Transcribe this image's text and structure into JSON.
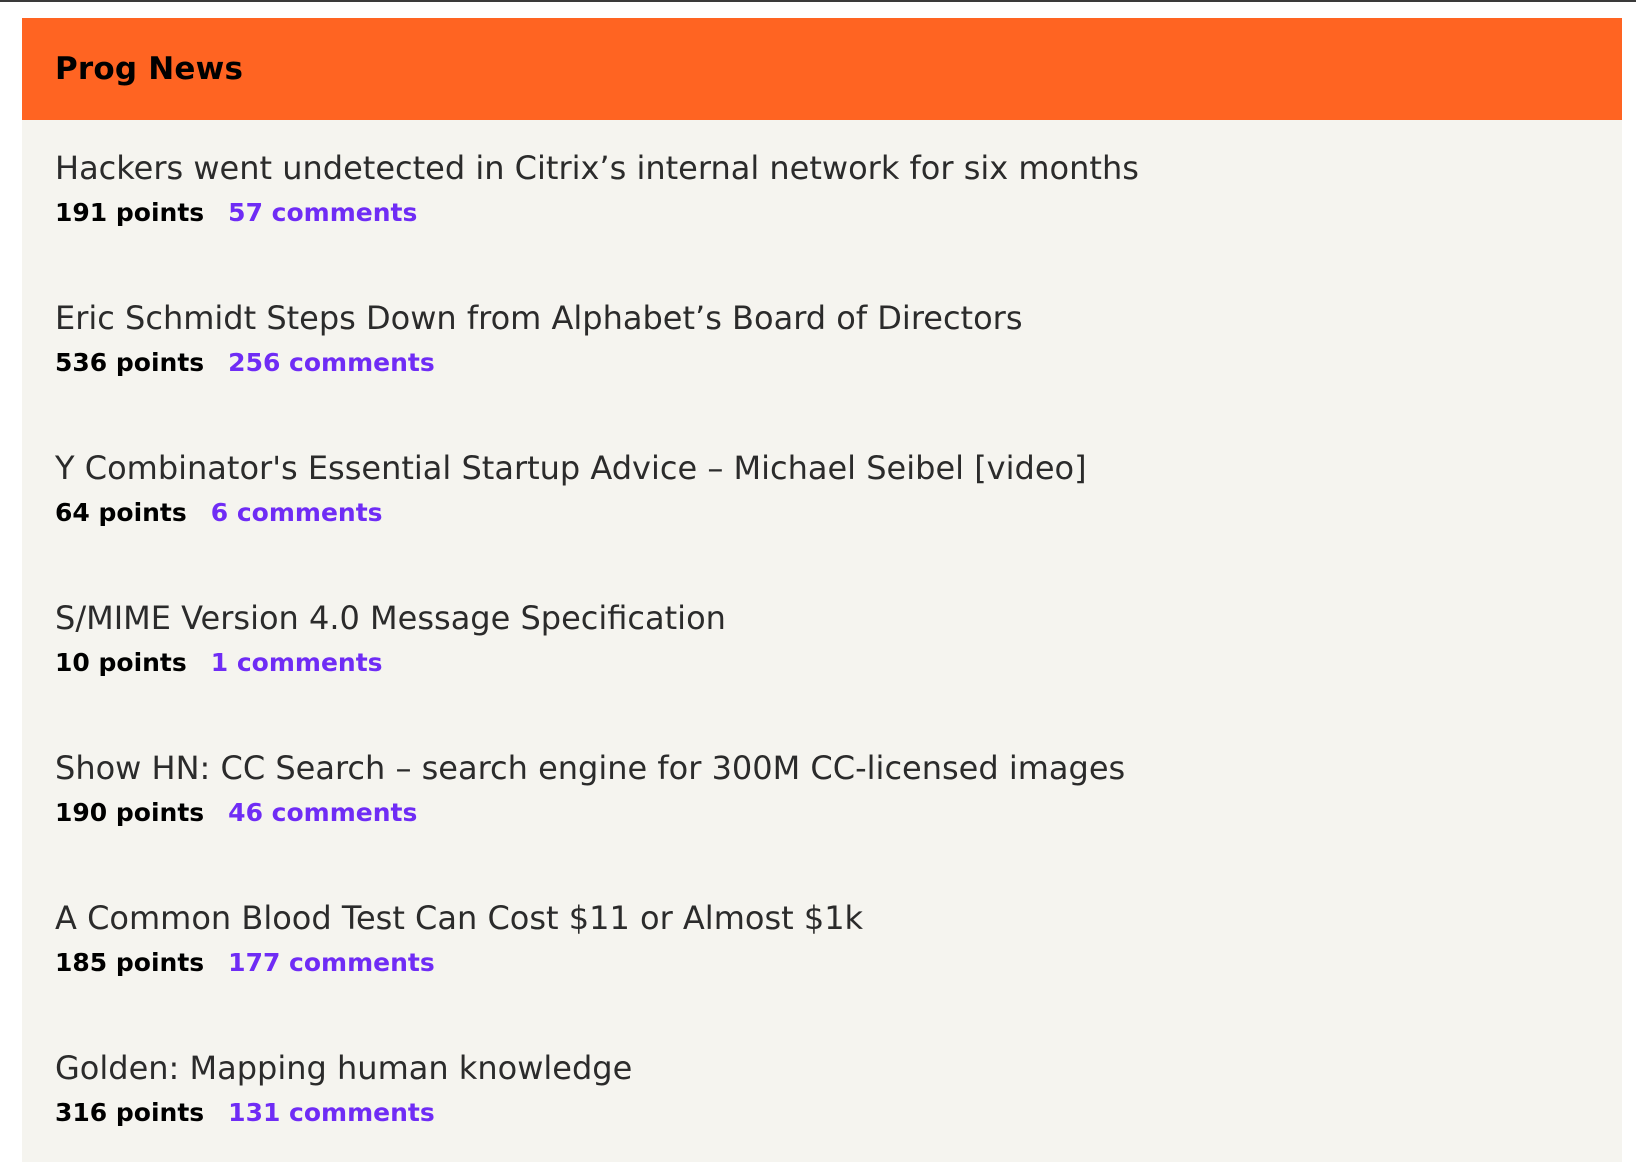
{
  "header": {
    "title": "Prog News"
  },
  "colors": {
    "header_bg": "#ff6422",
    "page_bg": "#f5f4ef",
    "comments_link": "#6f2cf5"
  },
  "stories": [
    {
      "title": "Hackers went undetected in Citrix’s internal network for six months",
      "points": "191 points",
      "comments": "57 comments"
    },
    {
      "title": "Eric Schmidt Steps Down from Alphabet’s Board of Directors",
      "points": "536 points",
      "comments": "256 comments"
    },
    {
      "title": "Y Combinator's Essential Startup Advice – Michael Seibel [video]",
      "points": "64 points",
      "comments": "6 comments"
    },
    {
      "title": "S/MIME Version 4.0 Message Specification",
      "points": "10 points",
      "comments": "1 comments"
    },
    {
      "title": "Show HN: CC Search – search engine for 300M CC-licensed images",
      "points": "190 points",
      "comments": "46 comments"
    },
    {
      "title": "A Common Blood Test Can Cost $11 or Almost $1k",
      "points": "185 points",
      "comments": "177 comments"
    },
    {
      "title": "Golden: Mapping human knowledge",
      "points": "316 points",
      "comments": "131 comments"
    }
  ]
}
